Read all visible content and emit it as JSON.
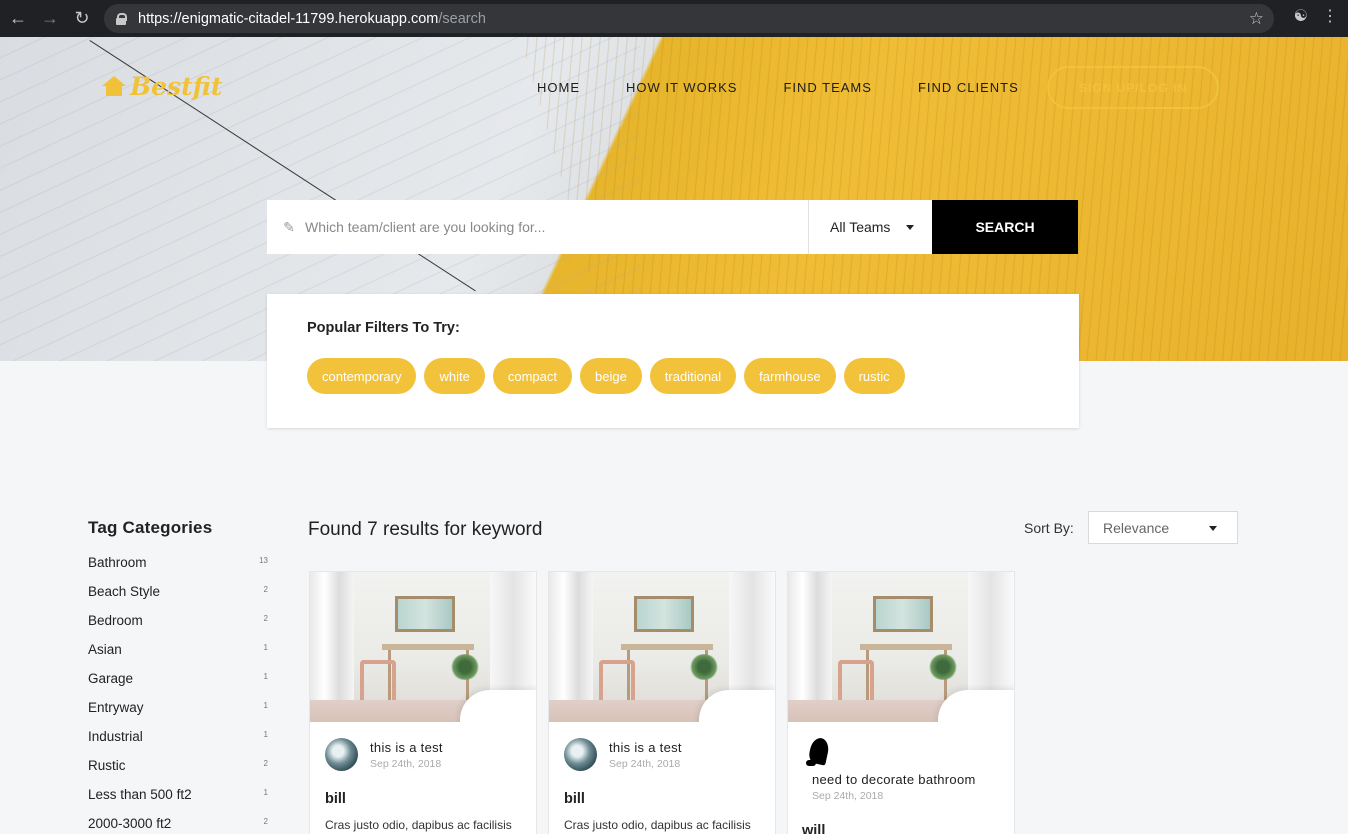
{
  "browser": {
    "url_host": "https://enigmatic-citadel-11799.herokuapp.com",
    "url_path": "/search"
  },
  "header": {
    "logo_text": "Bestfit",
    "nav": [
      "HOME",
      "HOW IT WORKS",
      "FIND TEAMS",
      "FIND CLIENTS"
    ],
    "signup_label": "SIGN UP/LOG IN"
  },
  "search": {
    "placeholder": "Which team/client are you looking for...",
    "value": "",
    "type_selected": "All Teams",
    "button_label": "SEARCH"
  },
  "filters": {
    "title": "Popular Filters To Try:",
    "chips": [
      "contemporary",
      "white",
      "compact",
      "beige",
      "traditional",
      "farmhouse",
      "rustic"
    ]
  },
  "sidebar": {
    "title": "Tag Categories",
    "tags": [
      {
        "name": "Bathroom",
        "count": "13"
      },
      {
        "name": "Beach Style",
        "count": "2"
      },
      {
        "name": "Bedroom",
        "count": "2"
      },
      {
        "name": "Asian",
        "count": "1"
      },
      {
        "name": "Garage",
        "count": "1"
      },
      {
        "name": "Entryway",
        "count": "1"
      },
      {
        "name": "Industrial",
        "count": "1"
      },
      {
        "name": "Rustic",
        "count": "2"
      },
      {
        "name": "Less than 500 ft2",
        "count": "1"
      },
      {
        "name": "2000-3000 ft2",
        "count": "2"
      }
    ]
  },
  "results": {
    "summary": "Found 7 results for keyword",
    "sort_label": "Sort By:",
    "sort_selected": "Relevance",
    "cards": [
      {
        "title": "this is a test",
        "date": "Sep 24th, 2018",
        "author": "bill",
        "description": "Cras justo odio, dapibus ac facilisis"
      },
      {
        "title": "this is a test",
        "date": "Sep 24th, 2018",
        "author": "bill",
        "description": "Cras justo odio, dapibus ac facilisis"
      },
      {
        "title": "need to decorate bathroom",
        "date": "Sep 24th, 2018",
        "author": "will",
        "description": ""
      }
    ]
  },
  "colors": {
    "accent": "#f2c23b",
    "dark": "#000000",
    "background": "#f5f6f8"
  }
}
